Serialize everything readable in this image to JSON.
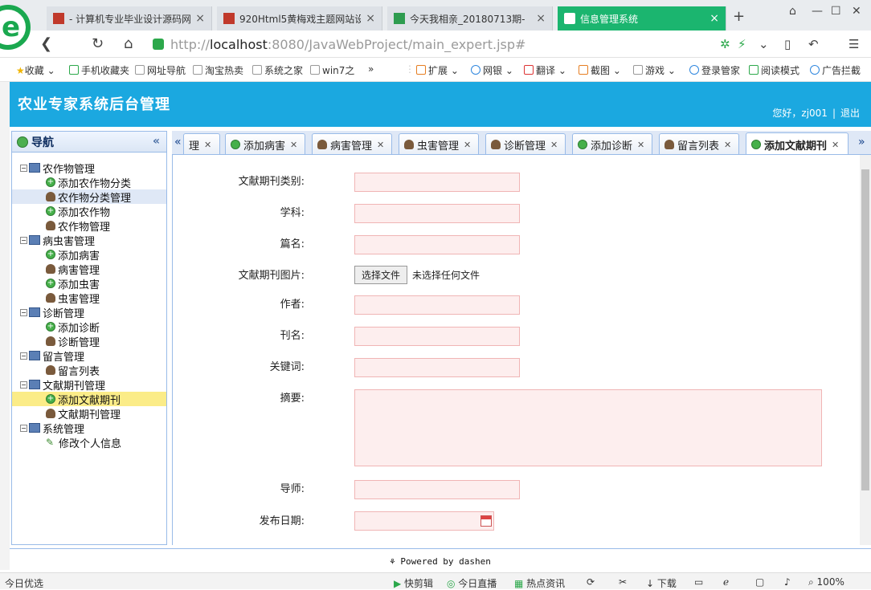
{
  "browser": {
    "tabs": [
      {
        "title": "- 计算机专业毕业设计源码网",
        "active": false
      },
      {
        "title": "920Html5黄梅戏主题网站设",
        "active": false
      },
      {
        "title": "今天我相亲_20180713期-",
        "active": false
      },
      {
        "title": "信息管理系统",
        "active": true
      }
    ],
    "url_prefix": "http://",
    "url_host": "localhost",
    "url_rest": ":8080/JavaWebProject/main_expert.jsp#",
    "bookmarks": [
      "收藏",
      "手机收藏夹",
      "网址导航",
      "淘宝热卖",
      "系统之家",
      "win7之",
      "»",
      "扩展",
      "网银",
      "翻译",
      "截图",
      "游戏",
      "登录管家",
      "阅读模式",
      "广告拦截"
    ],
    "status_left": "今日优选",
    "status_items": [
      "快剪辑",
      "今日直播",
      "热点资讯",
      "下载",
      "100%"
    ],
    "accent": "#1bb56f"
  },
  "app": {
    "title": "农业专家系统后台管理",
    "greeting": "您好，zj001",
    "logout": "退出",
    "header_color": "#1ba8e0",
    "nav_title": "导航",
    "tree": [
      {
        "label": "农作物管理",
        "level": 0,
        "icon": "pc"
      },
      {
        "label": "添加农作物分类",
        "level": 1,
        "icon": "add"
      },
      {
        "label": "农作物分类管理",
        "level": 1,
        "icon": "user",
        "hl": true
      },
      {
        "label": "添加农作物",
        "level": 1,
        "icon": "add"
      },
      {
        "label": "农作物管理",
        "level": 1,
        "icon": "user"
      },
      {
        "label": "病虫害管理",
        "level": 0,
        "icon": "pc"
      },
      {
        "label": "添加病害",
        "level": 1,
        "icon": "add"
      },
      {
        "label": "病害管理",
        "level": 1,
        "icon": "user"
      },
      {
        "label": "添加虫害",
        "level": 1,
        "icon": "add"
      },
      {
        "label": "虫害管理",
        "level": 1,
        "icon": "user"
      },
      {
        "label": "诊断管理",
        "level": 0,
        "icon": "pc"
      },
      {
        "label": "添加诊断",
        "level": 1,
        "icon": "add"
      },
      {
        "label": "诊断管理",
        "level": 1,
        "icon": "user"
      },
      {
        "label": "留言管理",
        "level": 0,
        "icon": "pc"
      },
      {
        "label": "留言列表",
        "level": 1,
        "icon": "user"
      },
      {
        "label": "文献期刊管理",
        "level": 0,
        "icon": "pc"
      },
      {
        "label": "添加文献期刊",
        "level": 1,
        "icon": "add",
        "sel": true
      },
      {
        "label": "文献期刊管理",
        "level": 1,
        "icon": "user"
      },
      {
        "label": "系统管理",
        "level": 0,
        "icon": "pc"
      },
      {
        "label": "修改个人信息",
        "level": 1,
        "icon": "pen"
      }
    ],
    "tabs": [
      {
        "label": "理",
        "icon": "none"
      },
      {
        "label": "添加病害",
        "icon": "add"
      },
      {
        "label": "病害管理",
        "icon": "user"
      },
      {
        "label": "虫害管理",
        "icon": "user"
      },
      {
        "label": "诊断管理",
        "icon": "user"
      },
      {
        "label": "添加诊断",
        "icon": "add"
      },
      {
        "label": "留言列表",
        "icon": "user"
      },
      {
        "label": "添加文献期刊",
        "icon": "add",
        "active": true
      }
    ],
    "form": {
      "category_label": "文献期刊类别:",
      "subject_label": "学科:",
      "title_label": "篇名:",
      "image_label": "文献期刊图片:",
      "file_button": "选择文件",
      "file_status": "未选择任何文件",
      "author_label": "作者:",
      "journal_label": "刊名:",
      "keywords_label": "关键词:",
      "abstract_label": "摘要:",
      "mentor_label": "导师:",
      "date_label": "发布日期:"
    },
    "footer": "Powered by dashen"
  }
}
